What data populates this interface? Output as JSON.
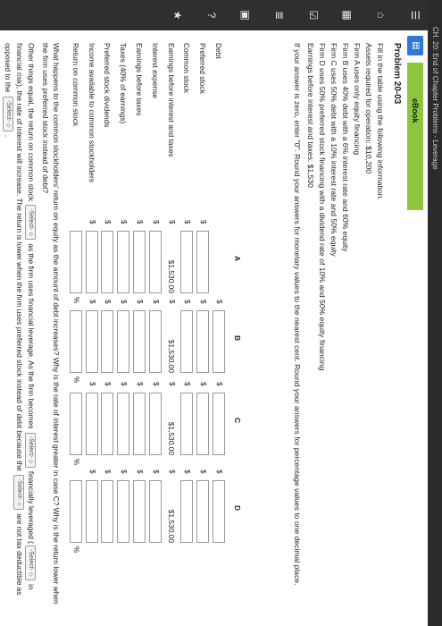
{
  "topbar": {
    "crumb": "CH. 20: End of Chapter Problems - Leverage"
  },
  "rail_icons": [
    "menu-icon",
    "home-icon",
    "ebook-icon",
    "checklist-icon",
    "list-icon",
    "bookmark-icon",
    "help-icon",
    "star-icon"
  ],
  "ebook": {
    "label": "eBook",
    "icon_glyph": "▤"
  },
  "problem": {
    "title": "Problem 20-03",
    "intro": "Fill in the table using the following information.",
    "lines": [
      "Assets required for operation: $10,200",
      "Firm A uses only equity financing",
      "Firm B uses 40% debt with a 6% interest rate and 60% equity",
      "Firm C uses 50% debt with a 10% interest rate and 50% equity",
      "Firm D uses 50% preferred stock financing with a dividend rate of 10% and 50% equity financing",
      "Earnings before interest and taxes: $1,530"
    ],
    "instruction": "If your answer is zero, enter \"0\". Round your answers for monetary values to the nearest cent. Round your answers for percentage values to one decimal place."
  },
  "table": {
    "columns": [
      "A",
      "B",
      "C",
      "D"
    ],
    "rows": [
      {
        "label": "Debt"
      },
      {
        "label": "Preferred stock"
      },
      {
        "label": "Common stock"
      },
      {
        "label": "Earnings before interest and taxes",
        "value": "$1,530.00"
      },
      {
        "label": "Interest expense"
      },
      {
        "label": "Earnings before taxes"
      },
      {
        "label": "Taxes (40% of earnings)"
      },
      {
        "label": "Preferred stock dividends"
      },
      {
        "label": "Income available to common stockholders"
      },
      {
        "label": "Return on common stock"
      }
    ],
    "dollar_sign": "$",
    "percent_sign": "%"
  },
  "questions": {
    "q1": "What happens to the common stockholders' return on equity as the amount of debt increases? Why is the rate of interest greater in case C? Why is the return lower when the firm uses preferred stock instead of debt?",
    "p1_a": "Other things equal, the return on common stock",
    "p1_b": "as the firm uses financial leverage. As the firm becomes",
    "p1_c": "financially leveraged",
    "p2_a": "(",
    "p2_b": "in financial risk), the rate of interest will increase. The return is lower when the firm uses preferred stock instead of debt because the",
    "p3_b": "are not tax deductible as opposed to the",
    "p3_c": ".",
    "select_label": "-Select-"
  }
}
